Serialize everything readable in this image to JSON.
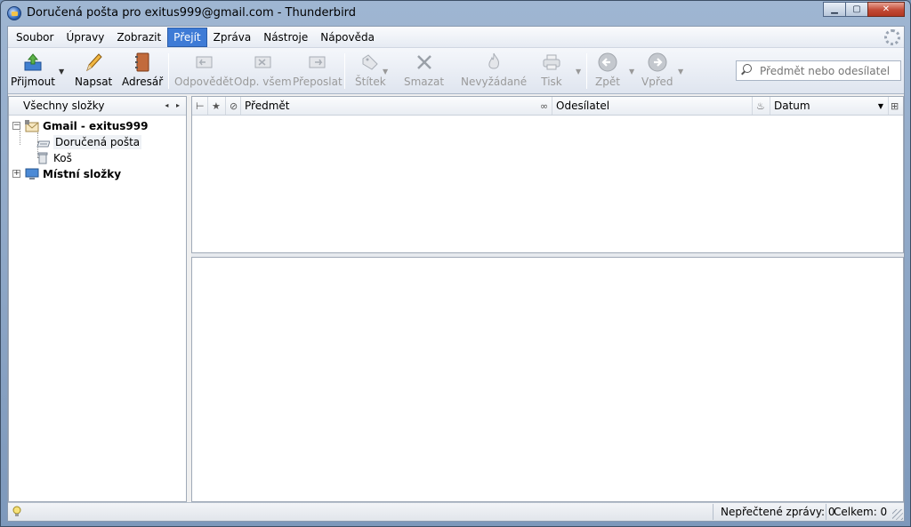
{
  "window": {
    "title": "Doručená pošta pro exitus999@gmail.com - Thunderbird",
    "minimize_glyph": "▁",
    "maximize_glyph": "▢",
    "close_glyph": "✕"
  },
  "menubar": {
    "items": [
      {
        "label": "Soubor"
      },
      {
        "label": "Úpravy"
      },
      {
        "label": "Zobrazit"
      },
      {
        "label": "Přejít",
        "active": true
      },
      {
        "label": "Zpráva"
      },
      {
        "label": "Nástroje"
      },
      {
        "label": "Nápověda"
      }
    ]
  },
  "toolbar": {
    "get_mail": "Přijmout",
    "write": "Napsat",
    "address_book": "Adresář",
    "reply": "Odpovědět",
    "reply_all": "Odp. všem",
    "forward": "Přeposlat",
    "tag": "Štítek",
    "delete": "Smazat",
    "junk": "Nevyžádané",
    "print": "Tisk",
    "back": "Zpět",
    "forward_nav": "Vpřed",
    "search_placeholder": "Předmět nebo odesílatel"
  },
  "folder_pane": {
    "header": "Všechny složky",
    "arrows": "◂ ▸",
    "account": "Gmail - exitus999",
    "inbox": "Doručená pošta",
    "trash": "Koš",
    "local": "Místní složky"
  },
  "thread_pane": {
    "columns": {
      "subject": "Předmět",
      "sender": "Odesílatel",
      "date": "Datum"
    }
  },
  "statusbar": {
    "unread": "Nepřečtené zprávy: 0",
    "total": "Celkem: 0"
  },
  "colors": {
    "menu_active": "#3e7bd6",
    "close_button": "#c24a35"
  }
}
